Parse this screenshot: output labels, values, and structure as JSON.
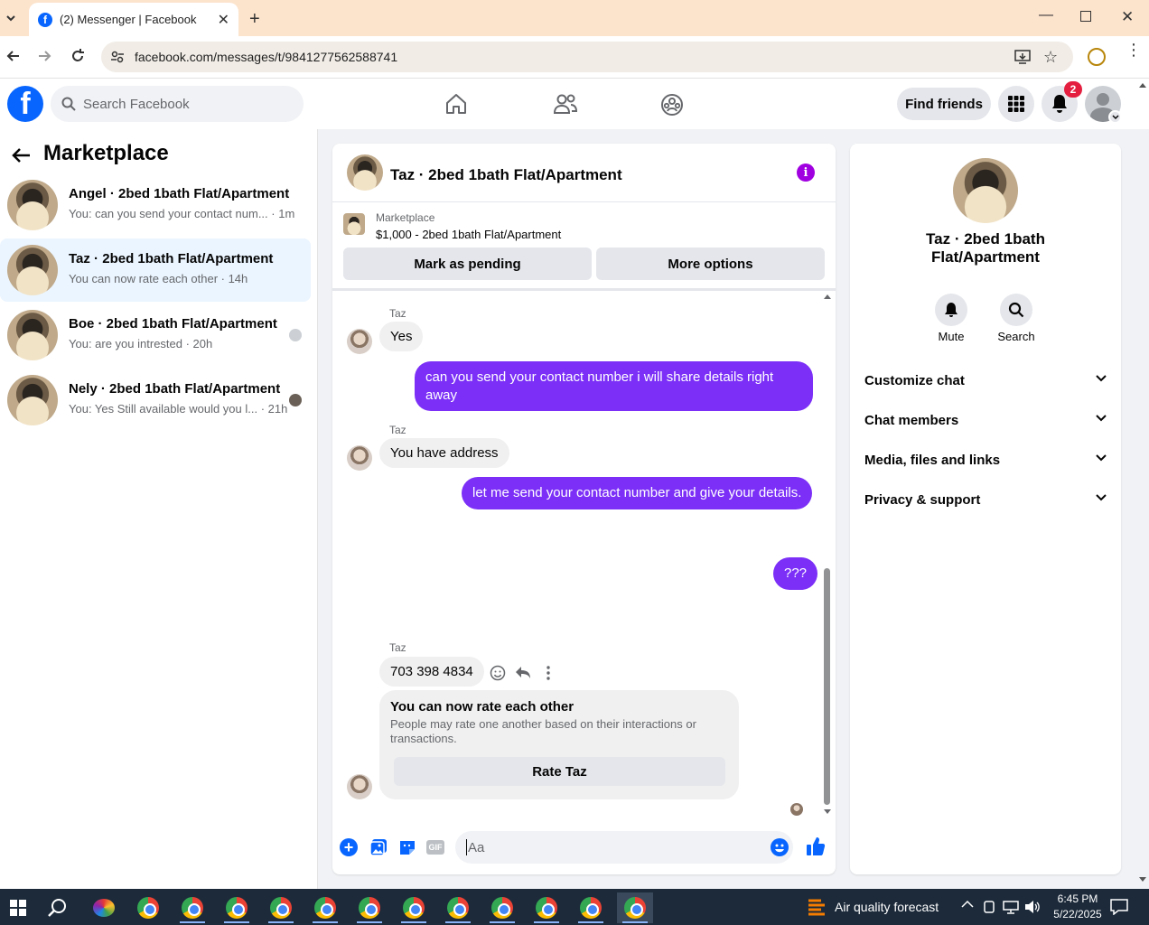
{
  "browser": {
    "tab_title": "(2) Messenger | Facebook",
    "url": "facebook.com/messages/t/9841277562588741"
  },
  "fb_header": {
    "search_placeholder": "Search Facebook",
    "find_friends": "Find friends",
    "notification_count": "2"
  },
  "sidebar": {
    "title": "Marketplace",
    "conversations": [
      {
        "name": "Angel · 2bed 1bath Flat/Apartment",
        "preview": "You: can you send your contact num... · 1m"
      },
      {
        "name": "Taz · 2bed 1bath Flat/Apartment",
        "preview": "You can now rate each other · 14h"
      },
      {
        "name": "Boe · 2bed 1bath Flat/Apartment",
        "preview": "You: are you intrested · 20h"
      },
      {
        "name": "Nely · 2bed 1bath Flat/Apartment",
        "preview": "You: Yes Still available would you l... · 21h"
      }
    ]
  },
  "chat": {
    "title": "Taz · 2bed 1bath Flat/Apartment",
    "listing_label": "Marketplace",
    "listing_desc": "$1,000 - 2bed 1bath Flat/Apartment",
    "mark_pending": "Mark as pending",
    "more_options": "More options",
    "messages": [
      {
        "sender": "Taz",
        "text": "Yes"
      },
      {
        "text": "can you send your contact number i will share details right away"
      },
      {
        "sender": "Taz",
        "text": "You have address"
      },
      {
        "text": "let me send your contact number and give your details."
      },
      {
        "text": "???"
      },
      {
        "sender": "Taz",
        "text": "703 398 4834"
      }
    ],
    "rate_card": {
      "title": "You can now rate each other",
      "desc": "People may rate one another based on their interactions or transactions.",
      "button": "Rate Taz"
    },
    "composer_placeholder": "Aa",
    "gif_label": "GIF"
  },
  "info_panel": {
    "name": "Taz · 2bed 1bath Flat/Apartment",
    "mute": "Mute",
    "search": "Search",
    "sections": [
      "Customize chat",
      "Chat members",
      "Media, files and links",
      "Privacy & support"
    ]
  },
  "taskbar": {
    "weather": "Air quality forecast",
    "time": "6:45 PM",
    "date": "5/22/2025"
  },
  "colors": {
    "accent": "#7b2ff7",
    "facebook_blue": "#0866ff"
  }
}
